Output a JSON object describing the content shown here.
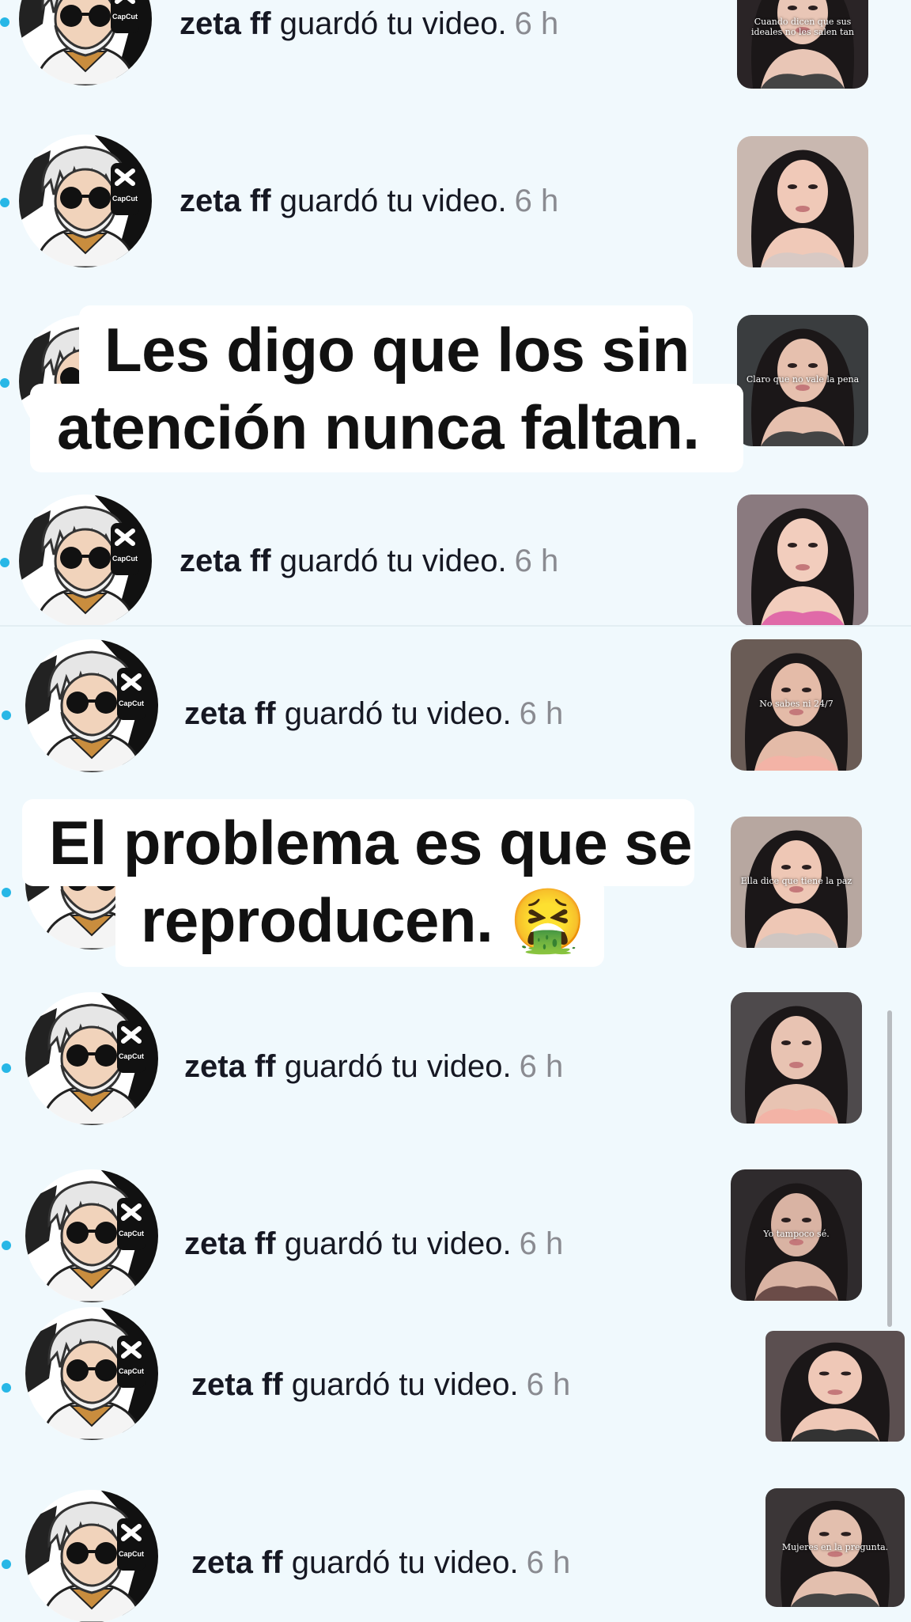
{
  "notification": {
    "user": "zeta ff",
    "action": " guardó tu video.",
    "time": "6 h"
  },
  "avatar": {
    "brand": "CapCut",
    "icon": "capcut-logo-icon"
  },
  "thumb_captions": [
    "Cuando dicen que sus ideales no les salen tan",
    "",
    "Claro que no vale la pena",
    "",
    "No sabes ni 24/7",
    "Ella dice que tiene la paz",
    "",
    "Yo tampoco sé.",
    "",
    "Mujeres en la pregunta."
  ],
  "overlay_captions": {
    "first": [
      "Les digo que los sin",
      "atención nunca faltan."
    ],
    "second": [
      "El problema es que se",
      "reproducen. 🤮"
    ]
  },
  "colors": {
    "background": "#f1f9fd",
    "unread_dot": "#27b7e6",
    "time": "#8a8b91"
  }
}
